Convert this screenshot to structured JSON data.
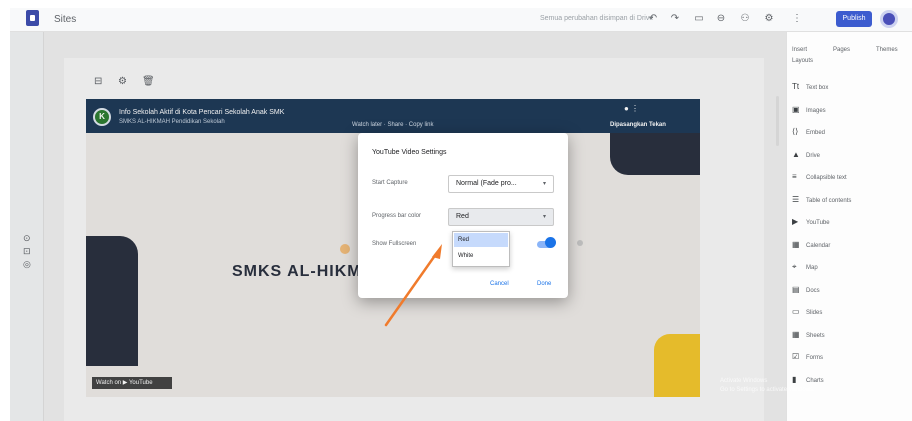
{
  "app": {
    "title": "Sites"
  },
  "toolbar": {
    "status": "Semua perubahan disimpan di Drive",
    "publish_label": "Publish",
    "icons": [
      "undo-icon",
      "redo-icon",
      "preview-icon",
      "link-icon",
      "add-person-icon",
      "settings-icon",
      "more-icon"
    ]
  },
  "video": {
    "channel_initial": "K",
    "title": "Info Sekolah Aktif di Kota Pencari Sekolah Anak SMK",
    "subtitle": "SMKS AL-HIKMAH Pendidikan Sekolah",
    "nav": "Watch later · Share · Copy link",
    "cta": "Dipasangkan Tekan",
    "school_name": "SMKS AL-HIKMAH",
    "watermark": "Watch on ▶ YouTube"
  },
  "dialog": {
    "title": "YouTube Video Settings",
    "start_label": "Start Capture",
    "start_value": "Normal (Fade pro...",
    "progress_label": "Progress bar color",
    "progress_value": "Red",
    "controls_label": "Show Fullscreen",
    "controls_enabled": true,
    "options": [
      "Red",
      "White"
    ],
    "selected_option": "Red",
    "cancel_label": "Cancel",
    "done_label": "Done"
  },
  "panel": {
    "tabs": [
      "Insert",
      "Pages",
      "Themes"
    ],
    "subtab": "Layouts",
    "items": [
      {
        "label": "Text box",
        "icon": "text-icon"
      },
      {
        "label": "Images",
        "icon": "image-icon"
      },
      {
        "label": "Embed",
        "icon": "embed-icon"
      },
      {
        "label": "Drive",
        "icon": "drive-icon"
      },
      {
        "label": "Collapsible text",
        "icon": "collapse-icon"
      },
      {
        "label": "Table of contents",
        "icon": "toc-icon"
      },
      {
        "label": "YouTube",
        "icon": "youtube-icon"
      },
      {
        "label": "Calendar",
        "icon": "calendar-icon"
      },
      {
        "label": "Map",
        "icon": "map-icon"
      },
      {
        "label": "Docs",
        "icon": "docs-icon"
      },
      {
        "label": "Slides",
        "icon": "slides-icon"
      },
      {
        "label": "Sheets",
        "icon": "sheets-icon"
      },
      {
        "label": "Forms",
        "icon": "forms-icon"
      },
      {
        "label": "Charts",
        "icon": "charts-icon"
      }
    ]
  },
  "system": {
    "activate_line1": "Activate Windows",
    "activate_line2": "Go to Settings to activate Windows."
  }
}
